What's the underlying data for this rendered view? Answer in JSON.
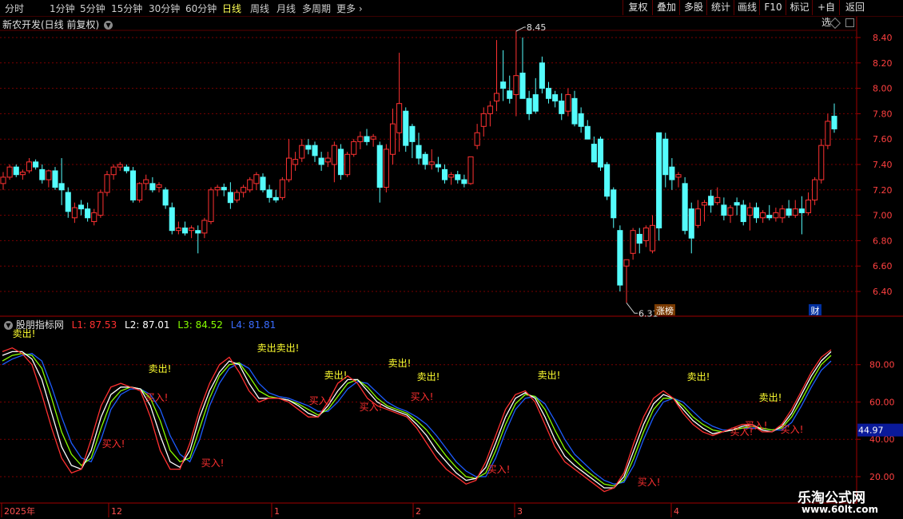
{
  "toolbar": {
    "timeframes": [
      "分时",
      "1分钟",
      "5分钟",
      "15分钟",
      "30分钟",
      "60分钟",
      "日线",
      "周线",
      "月线",
      "多周期",
      "更多"
    ],
    "active": "日线",
    "buttons": [
      "复权",
      "叠加",
      "多股",
      "统计",
      "画线",
      "F10",
      "标记",
      "+自选",
      "返回"
    ]
  },
  "main": {
    "title": "新农开发(日线 前复权)",
    "y_ticks": [
      "8.40",
      "8.20",
      "8.00",
      "7.80",
      "7.60",
      "7.40",
      "7.20",
      "7.00",
      "6.80",
      "6.60",
      "6.40"
    ],
    "high_label": "8.45",
    "low_label": "6.31",
    "tag_limitup": "涨榜",
    "tag_fin": "财"
  },
  "indicator": {
    "name": "股朋指标网",
    "l1": "L1: 87.53",
    "l2": "L2: 87.01",
    "l3": "L3: 84.52",
    "l4": "L4: 81.81",
    "y_ticks": [
      "80.00",
      "60.00",
      "40.00",
      "20.00"
    ],
    "current": "44.97",
    "sell_text": "卖出!",
    "buy_text": "买入!",
    "sell_double": "卖出卖出!"
  },
  "x_axis": {
    "labels": [
      "2025年",
      "12",
      "1",
      "2",
      "3",
      "4"
    ]
  },
  "watermark": {
    "line1": "乐淘公式网",
    "line2": "www.60lt.com"
  },
  "chart_data": [
    {
      "type": "candlestick",
      "title": "新农开发(日线 前复权)",
      "ylim": [
        6.3,
        8.55
      ],
      "up_color": "#ff3232",
      "down_color": "#54fcfc",
      "ohlc": [
        [
          7.25,
          7.34,
          7.2,
          7.3
        ],
        [
          7.3,
          7.4,
          7.28,
          7.38
        ],
        [
          7.38,
          7.4,
          7.3,
          7.32
        ],
        [
          7.32,
          7.36,
          7.28,
          7.34
        ],
        [
          7.35,
          7.45,
          7.33,
          7.42
        ],
        [
          7.42,
          7.44,
          7.36,
          7.38
        ],
        [
          7.36,
          7.4,
          7.25,
          7.28
        ],
        [
          7.28,
          7.36,
          7.22,
          7.35
        ],
        [
          7.35,
          7.38,
          7.2,
          7.22
        ],
        [
          7.25,
          7.45,
          7.08,
          7.2
        ],
        [
          7.18,
          7.22,
          6.98,
          7.03
        ],
        [
          6.98,
          7.1,
          6.94,
          7.06
        ],
        [
          7.08,
          7.12,
          7.0,
          7.05
        ],
        [
          7.05,
          7.1,
          6.95,
          6.98
        ],
        [
          6.95,
          7.05,
          6.92,
          7.02
        ],
        [
          7.0,
          7.2,
          6.98,
          7.18
        ],
        [
          7.18,
          7.35,
          7.15,
          7.32
        ],
        [
          7.32,
          7.4,
          7.28,
          7.38
        ],
        [
          7.38,
          7.42,
          7.35,
          7.4
        ],
        [
          7.38,
          7.4,
          7.33,
          7.35
        ],
        [
          7.35,
          7.38,
          7.1,
          7.12
        ],
        [
          7.12,
          7.26,
          7.1,
          7.25
        ],
        [
          7.25,
          7.32,
          7.2,
          7.28
        ],
        [
          7.25,
          7.3,
          7.18,
          7.2
        ],
        [
          7.22,
          7.26,
          7.18,
          7.24
        ],
        [
          7.2,
          7.22,
          7.05,
          7.08
        ],
        [
          7.06,
          7.1,
          6.85,
          6.88
        ],
        [
          6.88,
          6.95,
          6.85,
          6.9
        ],
        [
          6.9,
          6.95,
          6.84,
          6.86
        ],
        [
          6.88,
          6.92,
          6.82,
          6.9
        ],
        [
          6.88,
          6.92,
          6.7,
          6.86
        ],
        [
          6.86,
          6.98,
          6.82,
          6.96
        ],
        [
          6.95,
          7.22,
          6.93,
          7.2
        ],
        [
          7.2,
          7.24,
          7.15,
          7.22
        ],
        [
          7.22,
          7.25,
          7.15,
          7.2
        ],
        [
          7.18,
          7.26,
          7.05,
          7.1
        ],
        [
          7.12,
          7.2,
          7.1,
          7.18
        ],
        [
          7.18,
          7.24,
          7.14,
          7.22
        ],
        [
          7.2,
          7.3,
          7.18,
          7.28
        ],
        [
          7.25,
          7.34,
          7.2,
          7.32
        ],
        [
          7.3,
          7.33,
          7.18,
          7.2
        ],
        [
          7.2,
          7.24,
          7.1,
          7.14
        ],
        [
          7.14,
          7.2,
          7.1,
          7.12
        ],
        [
          7.14,
          7.3,
          7.12,
          7.28
        ],
        [
          7.28,
          7.6,
          7.26,
          7.45
        ],
        [
          7.4,
          7.5,
          7.35,
          7.44
        ],
        [
          7.45,
          7.6,
          7.42,
          7.55
        ],
        [
          7.55,
          7.6,
          7.48,
          7.52
        ],
        [
          7.55,
          7.58,
          7.42,
          7.47
        ],
        [
          7.45,
          7.5,
          7.35,
          7.4
        ],
        [
          7.42,
          7.5,
          7.38,
          7.45
        ],
        [
          7.4,
          7.58,
          7.26,
          7.55
        ],
        [
          7.52,
          7.56,
          7.28,
          7.32
        ],
        [
          7.32,
          7.5,
          7.3,
          7.48
        ],
        [
          7.48,
          7.6,
          7.46,
          7.58
        ],
        [
          7.58,
          7.66,
          7.52,
          7.62
        ],
        [
          7.62,
          7.68,
          7.55,
          7.58
        ],
        [
          7.6,
          7.64,
          7.54,
          7.62
        ],
        [
          7.55,
          7.58,
          7.1,
          7.22
        ],
        [
          7.22,
          7.56,
          7.18,
          7.52
        ],
        [
          7.48,
          7.84,
          7.4,
          7.72
        ],
        [
          7.65,
          8.28,
          7.5,
          7.88
        ],
        [
          7.82,
          7.85,
          7.5,
          7.55
        ],
        [
          7.7,
          7.72,
          7.45,
          7.58
        ],
        [
          7.55,
          7.65,
          7.4,
          7.45
        ],
        [
          7.48,
          7.5,
          7.36,
          7.4
        ],
        [
          7.4,
          7.52,
          7.36,
          7.42
        ],
        [
          7.4,
          7.46,
          7.34,
          7.38
        ],
        [
          7.36,
          7.4,
          7.25,
          7.28
        ],
        [
          7.3,
          7.34,
          7.24,
          7.32
        ],
        [
          7.32,
          7.35,
          7.25,
          7.28
        ],
        [
          7.28,
          7.32,
          7.22,
          7.25
        ],
        [
          7.25,
          7.46,
          7.24,
          7.46
        ],
        [
          7.55,
          7.72,
          7.52,
          7.65
        ],
        [
          7.7,
          7.85,
          7.62,
          7.8
        ],
        [
          7.8,
          7.9,
          7.7,
          7.86
        ],
        [
          7.9,
          8.38,
          7.82,
          7.96
        ],
        [
          8.05,
          8.3,
          7.9,
          8.0
        ],
        [
          7.98,
          8.1,
          7.88,
          7.92
        ],
        [
          7.95,
          8.45,
          7.78,
          8.1
        ],
        [
          8.12,
          8.4,
          8.0,
          7.92
        ],
        [
          7.92,
          7.98,
          7.75,
          7.8
        ],
        [
          7.95,
          8.08,
          7.8,
          7.82
        ],
        [
          8.2,
          8.25,
          7.96,
          8.0
        ],
        [
          8.0,
          8.05,
          7.88,
          7.92
        ],
        [
          7.95,
          7.98,
          7.85,
          7.9
        ],
        [
          7.9,
          7.96,
          7.75,
          7.8
        ],
        [
          7.82,
          8.0,
          7.78,
          7.95
        ],
        [
          7.92,
          7.98,
          7.7,
          7.72
        ],
        [
          7.8,
          7.85,
          7.65,
          7.7
        ],
        [
          7.7,
          7.75,
          7.6,
          7.6
        ],
        [
          7.56,
          7.62,
          7.42,
          7.42
        ],
        [
          7.6,
          7.62,
          7.35,
          7.38
        ],
        [
          7.4,
          7.42,
          7.12,
          7.15
        ],
        [
          7.2,
          7.22,
          6.9,
          6.98
        ],
        [
          6.88,
          6.92,
          6.4,
          6.45
        ],
        [
          6.6,
          6.65,
          6.31,
          6.65
        ],
        [
          6.7,
          6.9,
          6.65,
          6.88
        ],
        [
          6.85,
          6.9,
          6.7,
          6.78
        ],
        [
          6.8,
          6.92,
          6.75,
          6.9
        ],
        [
          6.72,
          7.0,
          6.7,
          6.92
        ],
        [
          7.65,
          7.65,
          6.8,
          6.9
        ],
        [
          7.6,
          7.65,
          7.22,
          7.32
        ],
        [
          7.38,
          7.45,
          7.2,
          7.28
        ],
        [
          7.3,
          7.34,
          7.22,
          7.32
        ],
        [
          7.25,
          7.3,
          6.85,
          6.88
        ],
        [
          7.05,
          7.1,
          6.7,
          6.82
        ],
        [
          6.92,
          7.12,
          6.9,
          7.05
        ],
        [
          7.08,
          7.12,
          6.95,
          7.1
        ],
        [
          7.15,
          7.2,
          7.02,
          7.08
        ],
        [
          7.1,
          7.22,
          7.08,
          7.14
        ],
        [
          7.08,
          7.14,
          6.96,
          7.0
        ],
        [
          7.0,
          7.08,
          6.94,
          7.06
        ],
        [
          7.1,
          7.14,
          7.0,
          7.08
        ],
        [
          7.08,
          7.12,
          6.92,
          6.95
        ],
        [
          7.0,
          7.1,
          6.88,
          7.06
        ],
        [
          7.06,
          7.1,
          6.94,
          6.98
        ],
        [
          6.98,
          7.04,
          6.94,
          7.02
        ],
        [
          7.0,
          7.08,
          6.96,
          6.98
        ],
        [
          6.98,
          7.06,
          6.95,
          7.02
        ],
        [
          6.98,
          7.08,
          6.94,
          7.05
        ],
        [
          7.05,
          7.12,
          6.98,
          7.0
        ],
        [
          7.0,
          7.12,
          6.98,
          7.05
        ],
        [
          7.05,
          7.15,
          6.85,
          7.02
        ],
        [
          7.02,
          7.18,
          7.0,
          7.12
        ],
        [
          7.12,
          7.3,
          7.08,
          7.28
        ],
        [
          7.28,
          7.6,
          7.25,
          7.55
        ],
        [
          7.55,
          7.8,
          7.52,
          7.74
        ],
        [
          7.78,
          7.88,
          7.65,
          7.68
        ]
      ],
      "annotations": [
        {
          "text": "8.45",
          "type": "high"
        },
        {
          "text": "6.31",
          "type": "low"
        }
      ]
    },
    {
      "type": "line",
      "title": "股朋指标网",
      "ylim": [
        8,
        100
      ],
      "series": [
        {
          "name": "L1",
          "color": "#ff3030",
          "values": [
            87,
            89,
            86,
            80,
            64,
            46,
            30,
            22,
            24,
            40,
            58,
            68,
            70,
            68,
            66,
            52,
            34,
            24,
            24,
            38,
            56,
            70,
            80,
            84,
            76,
            66,
            60,
            62,
            62,
            60,
            56,
            52,
            52,
            60,
            70,
            74,
            70,
            62,
            58,
            56,
            54,
            52,
            46,
            38,
            30,
            24,
            20,
            16,
            18,
            28,
            42,
            56,
            64,
            66,
            60,
            48,
            36,
            28,
            24,
            20,
            16,
            12,
            14,
            22,
            38,
            52,
            62,
            66,
            62,
            54,
            48,
            44,
            42,
            44,
            46,
            48,
            48,
            44,
            44,
            48,
            56,
            66,
            76,
            84,
            88
          ]
        },
        {
          "name": "L2",
          "color": "#ffffff",
          "values": [
            85,
            87,
            87,
            83,
            72,
            54,
            36,
            26,
            24,
            34,
            52,
            64,
            68,
            68,
            67,
            58,
            42,
            28,
            25,
            34,
            52,
            66,
            76,
            82,
            80,
            70,
            62,
            62,
            62,
            61,
            58,
            54,
            52,
            58,
            66,
            72,
            72,
            66,
            60,
            57,
            55,
            53,
            48,
            42,
            34,
            28,
            22,
            18,
            19,
            25,
            38,
            52,
            62,
            65,
            62,
            52,
            40,
            31,
            26,
            22,
            18,
            14,
            14,
            20,
            34,
            48,
            59,
            64,
            62,
            56,
            50,
            46,
            43,
            44,
            45,
            47,
            48,
            45,
            44,
            47,
            54,
            64,
            74,
            82,
            87
          ]
        },
        {
          "name": "L3",
          "color": "#88ff00",
          "values": [
            82,
            85,
            86,
            85,
            78,
            62,
            44,
            32,
            26,
            30,
            46,
            60,
            66,
            68,
            67,
            62,
            50,
            34,
            28,
            30,
            46,
            62,
            74,
            80,
            81,
            74,
            66,
            63,
            62,
            61,
            59,
            56,
            53,
            56,
            63,
            70,
            72,
            68,
            62,
            58,
            56,
            54,
            50,
            45,
            38,
            31,
            25,
            20,
            19,
            22,
            34,
            48,
            59,
            64,
            63,
            56,
            45,
            35,
            29,
            24,
            20,
            16,
            15,
            18,
            30,
            44,
            56,
            62,
            62,
            58,
            52,
            48,
            45,
            44,
            45,
            46,
            47,
            46,
            45,
            46,
            52,
            61,
            71,
            80,
            85
          ]
        },
        {
          "name": "L4",
          "color": "#1d5cff",
          "values": [
            80,
            83,
            85,
            86,
            82,
            68,
            52,
            38,
            30,
            28,
            40,
            56,
            64,
            67,
            67,
            64,
            56,
            42,
            32,
            28,
            40,
            58,
            70,
            78,
            81,
            78,
            70,
            65,
            63,
            62,
            60,
            58,
            55,
            55,
            60,
            67,
            71,
            70,
            65,
            60,
            57,
            55,
            52,
            48,
            42,
            35,
            28,
            23,
            20,
            20,
            30,
            44,
            56,
            62,
            63,
            59,
            50,
            40,
            32,
            27,
            22,
            18,
            16,
            17,
            26,
            40,
            52,
            60,
            62,
            60,
            55,
            50,
            47,
            45,
            45,
            46,
            46,
            46,
            45,
            45,
            49,
            58,
            68,
            77,
            82
          ]
        }
      ],
      "signals": [
        {
          "text": "卖出!",
          "kind": "sell"
        },
        {
          "text": "卖出卖出!",
          "kind": "sell"
        },
        {
          "text": "卖出!",
          "kind": "sell"
        },
        {
          "text": "卖出!",
          "kind": "sell"
        },
        {
          "text": "卖出!",
          "kind": "sell"
        },
        {
          "text": "卖出!",
          "kind": "sell"
        },
        {
          "text": "卖出!",
          "kind": "sell"
        },
        {
          "text": "卖出!",
          "kind": "sell"
        },
        {
          "text": "卖出!",
          "kind": "sell"
        },
        {
          "text": "买入!",
          "kind": "buy"
        },
        {
          "text": "买入!",
          "kind": "buy"
        },
        {
          "text": "买入!",
          "kind": "buy"
        },
        {
          "text": "买入!",
          "kind": "buy"
        },
        {
          "text": "买入!",
          "kind": "buy"
        },
        {
          "text": "买入!",
          "kind": "buy"
        },
        {
          "text": "买入!",
          "kind": "buy"
        },
        {
          "text": "买入!",
          "kind": "buy"
        },
        {
          "text": "买入!",
          "kind": "buy"
        },
        {
          "text": "买入!",
          "kind": "buy"
        },
        {
          "text": "买入!",
          "kind": "buy"
        }
      ]
    }
  ]
}
